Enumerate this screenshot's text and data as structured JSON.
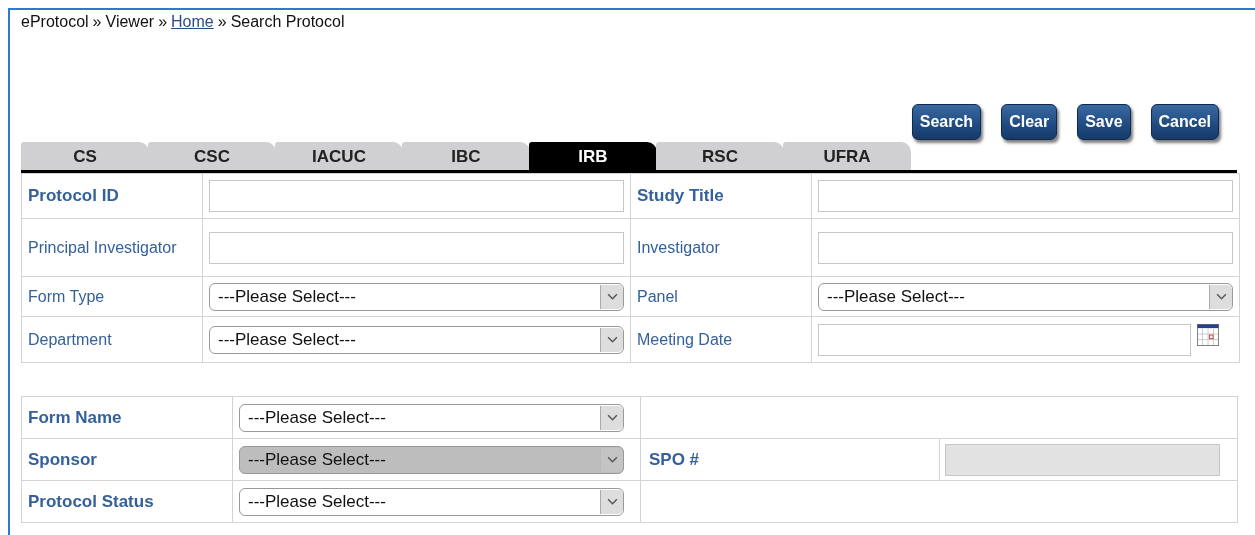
{
  "breadcrumb": [
    {
      "kind": "text",
      "text": "eProtocol"
    },
    {
      "kind": "separator",
      "text": "»"
    },
    {
      "kind": "text",
      "text": "Viewer"
    },
    {
      "kind": "separator",
      "text": "»"
    },
    {
      "kind": "link",
      "text": "Home"
    },
    {
      "kind": "separator",
      "text": "»"
    },
    {
      "kind": "text",
      "text": "Search Protocol"
    }
  ],
  "buttons": [
    "Search",
    "Clear",
    "Save",
    "Cancel"
  ],
  "tabs": [
    {
      "label": "CS",
      "selected": false
    },
    {
      "label": "CSC",
      "selected": false
    },
    {
      "label": "IACUC",
      "selected": false
    },
    {
      "label": "IBC",
      "selected": false
    },
    {
      "label": "IRB",
      "selected": true
    },
    {
      "label": "RSC",
      "selected": false
    },
    {
      "label": "UFRA",
      "selected": false
    }
  ],
  "criteria": [
    [
      {
        "label": "Protocol ID",
        "bold": true,
        "kind": "text"
      },
      {
        "label": "Study Title",
        "bold": true,
        "kind": "text"
      }
    ],
    [
      {
        "label": "Principal Investigator",
        "bold": false,
        "kind": "text"
      },
      {
        "label": "Investigator",
        "bold": false,
        "kind": "text"
      }
    ],
    [
      {
        "label": "Form Type",
        "bold": false,
        "kind": "select",
        "value": "---Please Select---"
      },
      {
        "label": "Panel",
        "bold": false,
        "kind": "select",
        "value": "---Please Select---"
      }
    ],
    [
      {
        "label": "Department",
        "bold": false,
        "kind": "select",
        "value": "---Please Select---"
      },
      {
        "label": "Meeting Date",
        "bold": false,
        "kind": "date"
      }
    ]
  ],
  "form_filters": [
    {
      "label": "Form Name",
      "kind": "select",
      "value": "---Please Select---",
      "disabled": false
    },
    {
      "label": "Sponsor",
      "kind": "select",
      "value": "---Please Select---",
      "disabled": true,
      "extra": {
        "label": "SPO #",
        "kind": "text",
        "disabled": true
      }
    },
    {
      "label": "Protocol Status",
      "kind": "select",
      "value": "---Please Select---",
      "disabled": false
    }
  ]
}
